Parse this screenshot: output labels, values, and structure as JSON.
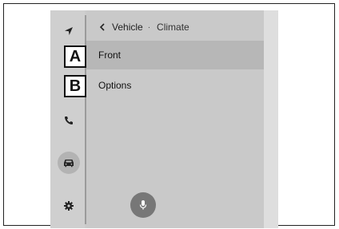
{
  "icons": {
    "nav": "navigation-arrow-icon",
    "phone": "phone-icon",
    "vehicle": "car-icon",
    "settings": "gear-icon",
    "back": "chevron-left-icon",
    "mic": "microphone-icon"
  },
  "breadcrumb": {
    "parent": "Vehicle",
    "separator": "·",
    "current": "Climate"
  },
  "menu": {
    "items": [
      {
        "label": "Front",
        "selected": true
      },
      {
        "label": "Options",
        "selected": false
      }
    ]
  },
  "callouts": {
    "a": "A",
    "b": "B"
  },
  "colors": {
    "selected_row": "#b7b7b7",
    "mic_button": "#777777"
  }
}
